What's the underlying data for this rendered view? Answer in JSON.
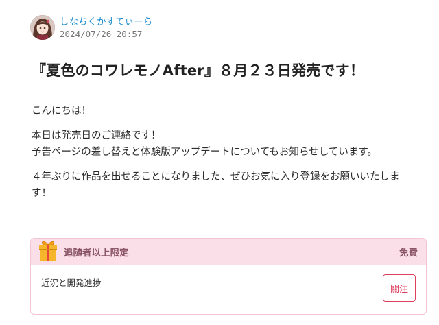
{
  "author": {
    "name": "しなちくかすてぃーら",
    "date": "2024/07/26 20:57"
  },
  "post": {
    "title": "『夏色のコワレモノAfter』８月２３日発売です！",
    "paragraphs": [
      "こんにちは！",
      "本日は発売日のご連絡です！",
      "予告ページの差し替えと体験版アップデートについてもお知らせしています。",
      "４年ぶりに作品を出せることになりました、ぜひお気に入り登録をお願いいたします！"
    ]
  },
  "plan": {
    "name": "追随者以上限定",
    "price": "免費",
    "description": "近況と開発進捗",
    "follow_label": "關注",
    "icon": "gift-icon"
  },
  "colors": {
    "link": "#1f8ecd",
    "plan_header_bg": "#fbdfe8",
    "plan_text": "#8a5566",
    "accent": "#e0405f"
  }
}
